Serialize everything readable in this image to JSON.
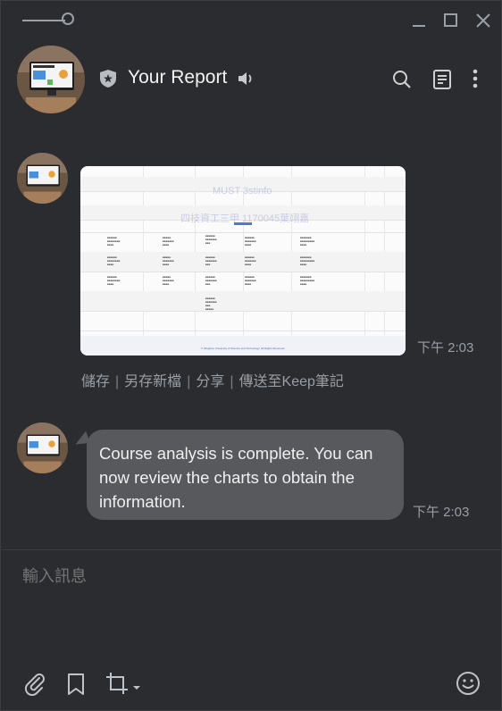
{
  "window": {
    "title": "Your Report",
    "controls": [
      "minimize-icon",
      "maximize-icon",
      "close-icon"
    ]
  },
  "header": {
    "title": "Your Report",
    "icons": [
      "shield-star-icon",
      "speaker-icon",
      "search-icon",
      "notes-icon",
      "more-vertical-icon"
    ]
  },
  "messages": [
    {
      "type": "image",
      "time": "下午 2:03",
      "image_watermarks": [
        "MUST 3stinfo",
        "四技資工三甲 1170045葉翊嘉"
      ],
      "image_footer": "© Minghsin University of Science and Technology. All Rights Reserved.",
      "actions": [
        "儲存",
        "另存新檔",
        "分享",
        "傳送至Keep筆記"
      ]
    },
    {
      "type": "text",
      "text": "Course analysis is complete. You can now review the charts to obtain the information.",
      "time": "下午 2:03"
    }
  ],
  "composer": {
    "placeholder": "輸入訊息",
    "icons": [
      "paperclip-icon",
      "bookmark-icon",
      "crop-icon",
      "emoji-icon"
    ]
  },
  "colors": {
    "background": "#2b2c2f",
    "bubble": "#58595d",
    "muted_text": "#9a9ea3"
  }
}
